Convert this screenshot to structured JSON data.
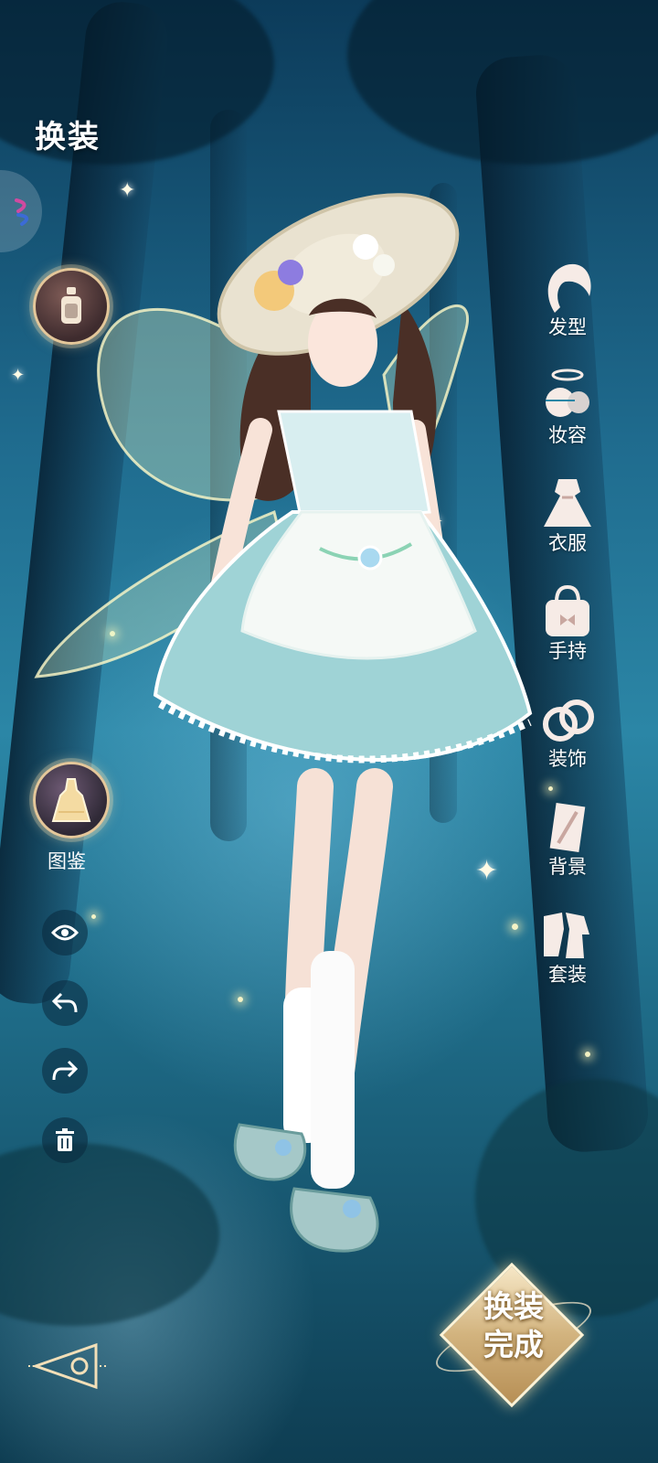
{
  "header": {
    "title": "换装"
  },
  "left_panel": {
    "codex_label": "图鉴"
  },
  "right_menu": [
    {
      "label": "发型",
      "icon": "hair-icon"
    },
    {
      "label": "妆容",
      "icon": "makeup-icon"
    },
    {
      "label": "衣服",
      "icon": "dress-icon"
    },
    {
      "label": "手持",
      "icon": "handbag-icon"
    },
    {
      "label": "装饰",
      "icon": "rings-icon"
    },
    {
      "label": "背景",
      "icon": "background-icon"
    },
    {
      "label": "套装",
      "icon": "suit-icon"
    }
  ],
  "finish_button": {
    "line1": "换装",
    "line2": "完成"
  },
  "colors": {
    "accent_gold": "#e4c79a",
    "bg_deep": "#0c3b5a",
    "bg_light": "#2b86a6"
  }
}
